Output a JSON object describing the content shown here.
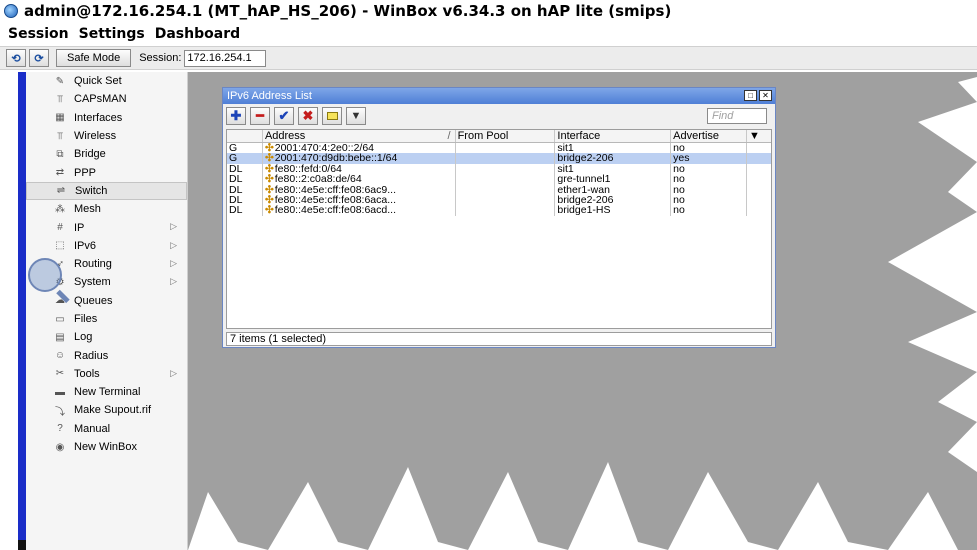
{
  "window": {
    "title": "admin@172.16.254.1 (MT_hAP_HS_206) - WinBox v6.34.3 on hAP lite (smips)"
  },
  "menu": [
    "Session",
    "Settings",
    "Dashboard"
  ],
  "toolbar": {
    "undo_icon": "undo-icon",
    "redo_icon": "redo-icon",
    "safe_mode": "Safe Mode",
    "session_label": "Session:",
    "session_value": "172.16.254.1"
  },
  "sidebar": {
    "items": [
      {
        "label": "Quick Set",
        "icon": "quickset-icon",
        "submenu": false
      },
      {
        "label": "CAPsMAN",
        "icon": "capsman-icon",
        "submenu": false
      },
      {
        "label": "Interfaces",
        "icon": "interfaces-icon",
        "submenu": false
      },
      {
        "label": "Wireless",
        "icon": "wireless-icon",
        "submenu": false
      },
      {
        "label": "Bridge",
        "icon": "bridge-icon",
        "submenu": false
      },
      {
        "label": "PPP",
        "icon": "ppp-icon",
        "submenu": false
      },
      {
        "label": "Switch",
        "icon": "switch-icon",
        "submenu": false
      },
      {
        "label": "Mesh",
        "icon": "mesh-icon",
        "submenu": false
      },
      {
        "label": "IP",
        "icon": "ip-icon",
        "submenu": true
      },
      {
        "label": "IPv6",
        "icon": "ipv6-icon",
        "submenu": true
      },
      {
        "label": "Routing",
        "icon": "routing-icon",
        "submenu": true
      },
      {
        "label": "System",
        "icon": "system-icon",
        "submenu": true
      },
      {
        "label": "Queues",
        "icon": "queues-icon",
        "submenu": false
      },
      {
        "label": "Files",
        "icon": "files-icon",
        "submenu": false
      },
      {
        "label": "Log",
        "icon": "log-icon",
        "submenu": false
      },
      {
        "label": "Radius",
        "icon": "radius-icon",
        "submenu": false
      },
      {
        "label": "Tools",
        "icon": "tools-icon",
        "submenu": true
      },
      {
        "label": "New Terminal",
        "icon": "terminal-icon",
        "submenu": false
      },
      {
        "label": "Make Supout.rif",
        "icon": "supout-icon",
        "submenu": false
      },
      {
        "label": "Manual",
        "icon": "manual-icon",
        "submenu": false
      },
      {
        "label": "New WinBox",
        "icon": "winbox-icon",
        "submenu": false
      }
    ]
  },
  "ipv6_window": {
    "title": "IPv6 Address List",
    "find_placeholder": "Find",
    "columns": [
      "",
      "Address",
      "From Pool",
      "Interface",
      "Advertise"
    ],
    "sort_indicator": "/",
    "rows": [
      {
        "flag": "G",
        "address": "2001:470:4:2e0::2/64",
        "pool": "",
        "interface": "sit1",
        "advertise": "no",
        "selected": false
      },
      {
        "flag": "G",
        "address": "2001:470:d9db:bebe::1/64",
        "pool": "",
        "interface": "bridge2-206",
        "advertise": "yes",
        "selected": true
      },
      {
        "flag": "DL",
        "address": "fe80::fefd:0/64",
        "pool": "",
        "interface": "sit1",
        "advertise": "no",
        "selected": false
      },
      {
        "flag": "DL",
        "address": "fe80::2:c0a8:de/64",
        "pool": "",
        "interface": "gre-tunnel1",
        "advertise": "no",
        "selected": false
      },
      {
        "flag": "DL",
        "address": "fe80::4e5e:cff:fe08:6ac9...",
        "pool": "",
        "interface": "ether1-wan",
        "advertise": "no",
        "selected": false
      },
      {
        "flag": "DL",
        "address": "fe80::4e5e:cff:fe08:6aca...",
        "pool": "",
        "interface": "bridge2-206",
        "advertise": "no",
        "selected": false
      },
      {
        "flag": "DL",
        "address": "fe80::4e5e:cff:fe08:6acd...",
        "pool": "",
        "interface": "bridge1-HS",
        "advertise": "no",
        "selected": false
      }
    ],
    "status": "7 items (1 selected)"
  },
  "colors": {
    "selection": "#bcd0f2",
    "title_bar": "#5a86d8",
    "desktop_shape": "#a0a0a0"
  }
}
